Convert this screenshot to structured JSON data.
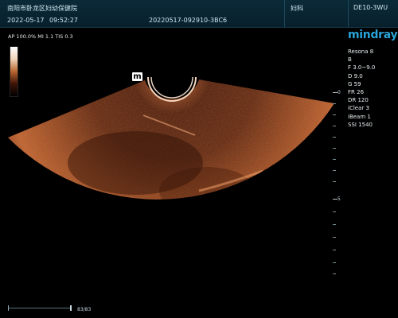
{
  "header": {
    "hospital": "南阳市卧龙区妇幼保健院",
    "date": "2022-05-17",
    "time": "09:52:27",
    "exam_id": "20220517-092910-3BC6",
    "department": "妇科",
    "probe": "DE10-3WU"
  },
  "acoustic_output": "AP 100.0%  MI 1.1  TIS 0.3",
  "brand": "mindray",
  "imaging_params": [
    "Resona 8",
    "B",
    "F 3.0~9.0",
    "D 9.0",
    "G 59",
    "FR 26",
    "DR 120",
    "iClear 3",
    "iBeam 1",
    "SSI 1540"
  ],
  "orientation_marker": "m",
  "depth_labels": [
    "0",
    "5"
  ],
  "cine": {
    "frames": "83/83"
  },
  "colors": {
    "header_bg": "#0b2a38",
    "brand": "#2aa4d7",
    "image_tint": "#d9703a"
  },
  "icons": [
    "orientation-marker-icon",
    "grayscale-bar",
    "depth-scale",
    "cine-bar"
  ]
}
